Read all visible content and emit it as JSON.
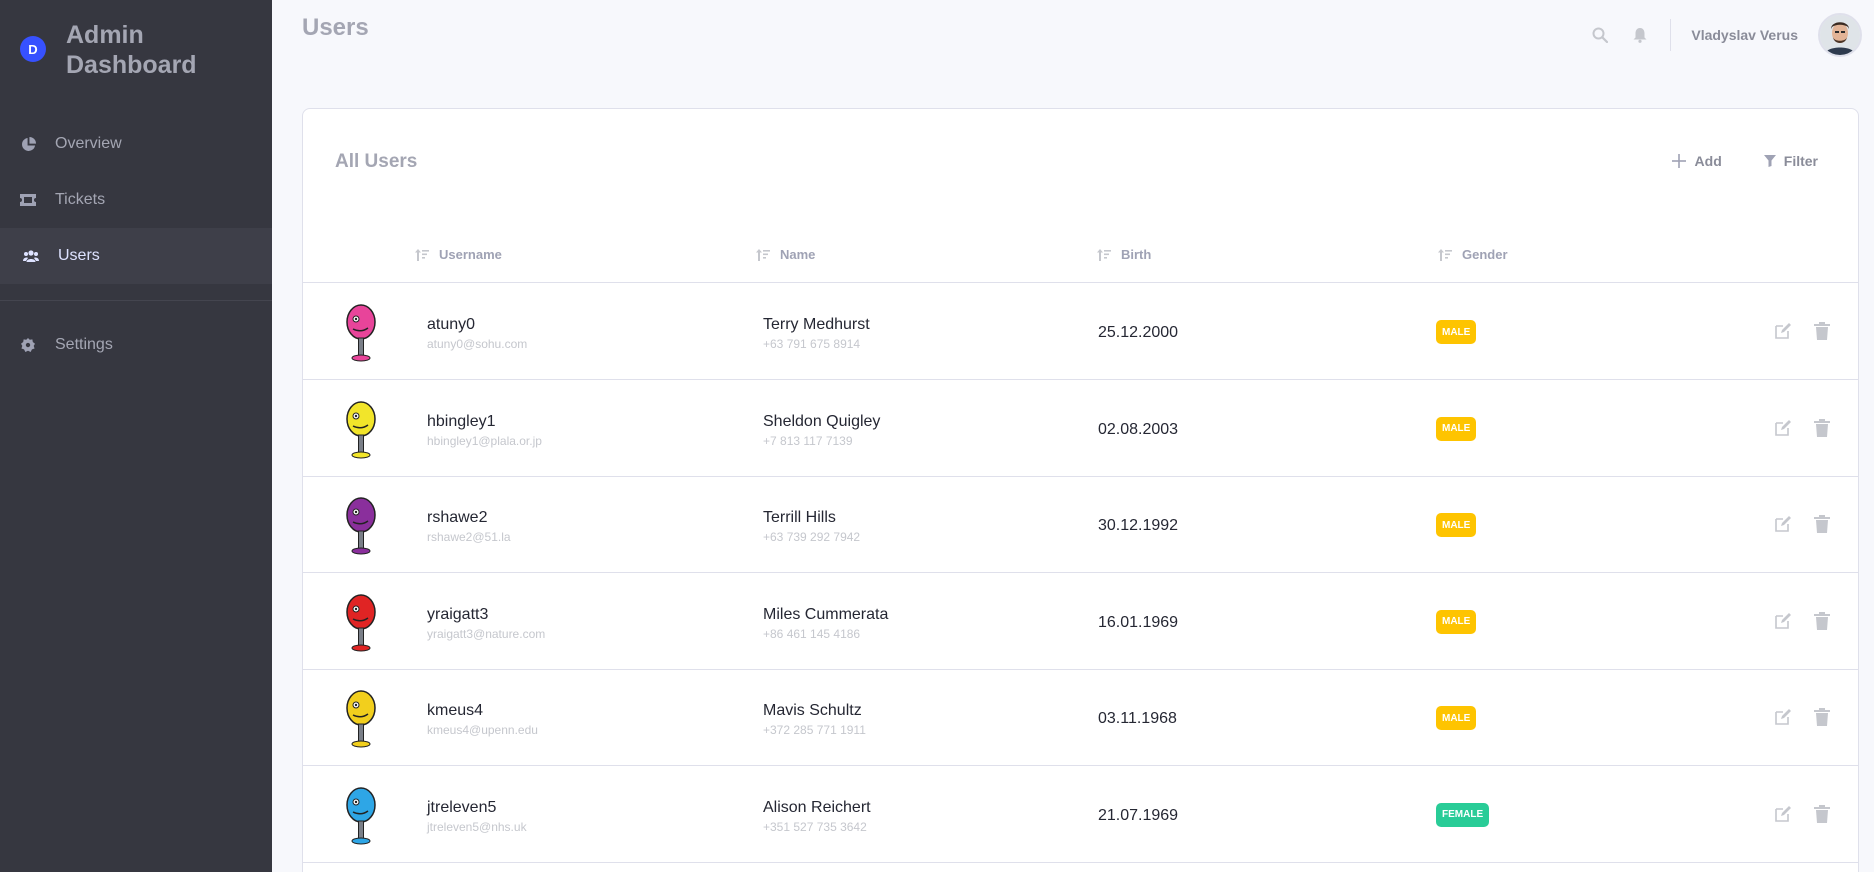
{
  "brand": {
    "logo_letter": "D",
    "title": "Admin Dashboard"
  },
  "sidebar": {
    "items": [
      {
        "label": "Overview",
        "icon": "pie-chart-icon"
      },
      {
        "label": "Tickets",
        "icon": "ticket-icon"
      },
      {
        "label": "Users",
        "icon": "users-icon",
        "active": true
      },
      {
        "label": "Settings",
        "icon": "gear-icon"
      }
    ]
  },
  "header": {
    "title": "Users",
    "user_name": "Vladyslav Verus"
  },
  "card": {
    "title": "All Users",
    "add_label": "Add",
    "filter_label": "Filter"
  },
  "table": {
    "columns": [
      "Username",
      "Name",
      "Birth",
      "Gender"
    ],
    "rows": [
      {
        "username": "atuny0",
        "email": "atuny0@sohu.com",
        "name": "Terry Medhurst",
        "phone": "+63 791 675 8914",
        "birth": "25.12.2000",
        "gender": "MALE",
        "avatar_color": "#e8449a"
      },
      {
        "username": "hbingley1",
        "email": "hbingley1@plala.or.jp",
        "name": "Sheldon Quigley",
        "phone": "+7 813 117 7139",
        "birth": "02.08.2003",
        "gender": "MALE",
        "avatar_color": "#f2e52a"
      },
      {
        "username": "rshawe2",
        "email": "rshawe2@51.la",
        "name": "Terrill Hills",
        "phone": "+63 739 292 7942",
        "birth": "30.12.1992",
        "gender": "MALE",
        "avatar_color": "#8a2f9c"
      },
      {
        "username": "yraigatt3",
        "email": "yraigatt3@nature.com",
        "name": "Miles Cummerata",
        "phone": "+86 461 145 4186",
        "birth": "16.01.1969",
        "gender": "MALE",
        "avatar_color": "#e02424"
      },
      {
        "username": "kmeus4",
        "email": "kmeus4@upenn.edu",
        "name": "Mavis Schultz",
        "phone": "+372 285 771 1911",
        "birth": "03.11.1968",
        "gender": "MALE",
        "avatar_color": "#f2cf1d"
      },
      {
        "username": "jtreleven5",
        "email": "jtreleven5@nhs.uk",
        "name": "Alison Reichert",
        "phone": "+351 527 735 3642",
        "birth": "21.07.1969",
        "gender": "FEMALE",
        "avatar_color": "#2ea6e6"
      }
    ]
  },
  "colors": {
    "sidebar_bg": "#363740",
    "accent": "#3751ff",
    "male_badge": "#fec400",
    "female_badge": "#29cc97"
  }
}
